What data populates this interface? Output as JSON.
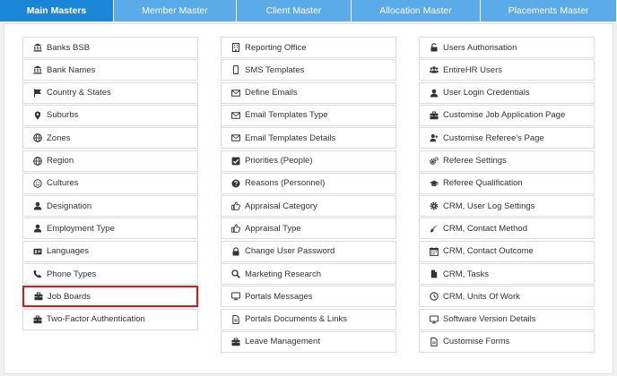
{
  "tabs": [
    {
      "label": "Main Masters",
      "active": true
    },
    {
      "label": "Member Master",
      "active": false
    },
    {
      "label": "Client Master",
      "active": false
    },
    {
      "label": "Allocation Master",
      "active": false
    },
    {
      "label": "Placements Master",
      "active": false
    }
  ],
  "columns": [
    [
      {
        "label": "Banks BSB",
        "icon": "bank-icon"
      },
      {
        "label": "Bank Names",
        "icon": "bank-icon"
      },
      {
        "label": "Country & States",
        "icon": "flag-icon"
      },
      {
        "label": "Suburbs",
        "icon": "map-pin-icon"
      },
      {
        "label": "Zones",
        "icon": "globe-icon"
      },
      {
        "label": "Region",
        "icon": "globe-icon"
      },
      {
        "label": "Cultures",
        "icon": "smile-icon"
      },
      {
        "label": "Designation",
        "icon": "user-icon"
      },
      {
        "label": "Employment Type",
        "icon": "user-icon"
      },
      {
        "label": "Languages",
        "icon": "id-card-icon"
      },
      {
        "label": "Phone Types",
        "icon": "phone-icon"
      },
      {
        "label": "Job Boards",
        "icon": "briefcase-icon",
        "highlighted": true
      },
      {
        "label": "Two-Factor Authentication",
        "icon": "briefcase-icon"
      }
    ],
    [
      {
        "label": "Reporting Office",
        "icon": "building-icon"
      },
      {
        "label": "SMS Templates",
        "icon": "mobile-icon"
      },
      {
        "label": "Define Emails",
        "icon": "envelope-icon"
      },
      {
        "label": "Email Templates Type",
        "icon": "envelope-icon"
      },
      {
        "label": "Email Templates Details",
        "icon": "envelope-icon"
      },
      {
        "label": "Priorities (People)",
        "icon": "check-square-icon"
      },
      {
        "label": "Reasons (Personnel)",
        "icon": "question-circle-icon"
      },
      {
        "label": "Appraisal Category",
        "icon": "thumbs-up-icon"
      },
      {
        "label": "Appraisal Type",
        "icon": "thumbs-up-icon"
      },
      {
        "label": "Change User Password",
        "icon": "lock-icon"
      },
      {
        "label": "Marketing Research",
        "icon": "search-icon"
      },
      {
        "label": "Portals Messages",
        "icon": "monitor-icon"
      },
      {
        "label": "Portals Documents & Links",
        "icon": "document-icon"
      },
      {
        "label": "Leave Management",
        "icon": "briefcase-icon"
      }
    ],
    [
      {
        "label": "Users Authorisation",
        "icon": "unlock-icon"
      },
      {
        "label": "EntireHR Users",
        "icon": "users-icon"
      },
      {
        "label": "User Login Credentials",
        "icon": "user-icon"
      },
      {
        "label": "Customise Job Application Page",
        "icon": "briefcase-icon"
      },
      {
        "label": "Customise Referee's Page",
        "icon": "user-plus-icon"
      },
      {
        "label": "Referee Settings",
        "icon": "cogs-icon"
      },
      {
        "label": "Referee Qualification",
        "icon": "graduation-cap-icon"
      },
      {
        "label": "CRM, User Log Settings",
        "icon": "gear-icon"
      },
      {
        "label": "CRM, Contact Method",
        "icon": "paint-brush-icon"
      },
      {
        "label": "CRM, Contact Outcome",
        "icon": "calendar-icon"
      },
      {
        "label": "CRM, Tasks",
        "icon": "file-icon"
      },
      {
        "label": "CRM, Units Of Work",
        "icon": "clock-icon"
      },
      {
        "label": "Software Version Details",
        "icon": "monitor-icon"
      },
      {
        "label": "Customise Forms",
        "icon": "document-icon"
      }
    ]
  ]
}
